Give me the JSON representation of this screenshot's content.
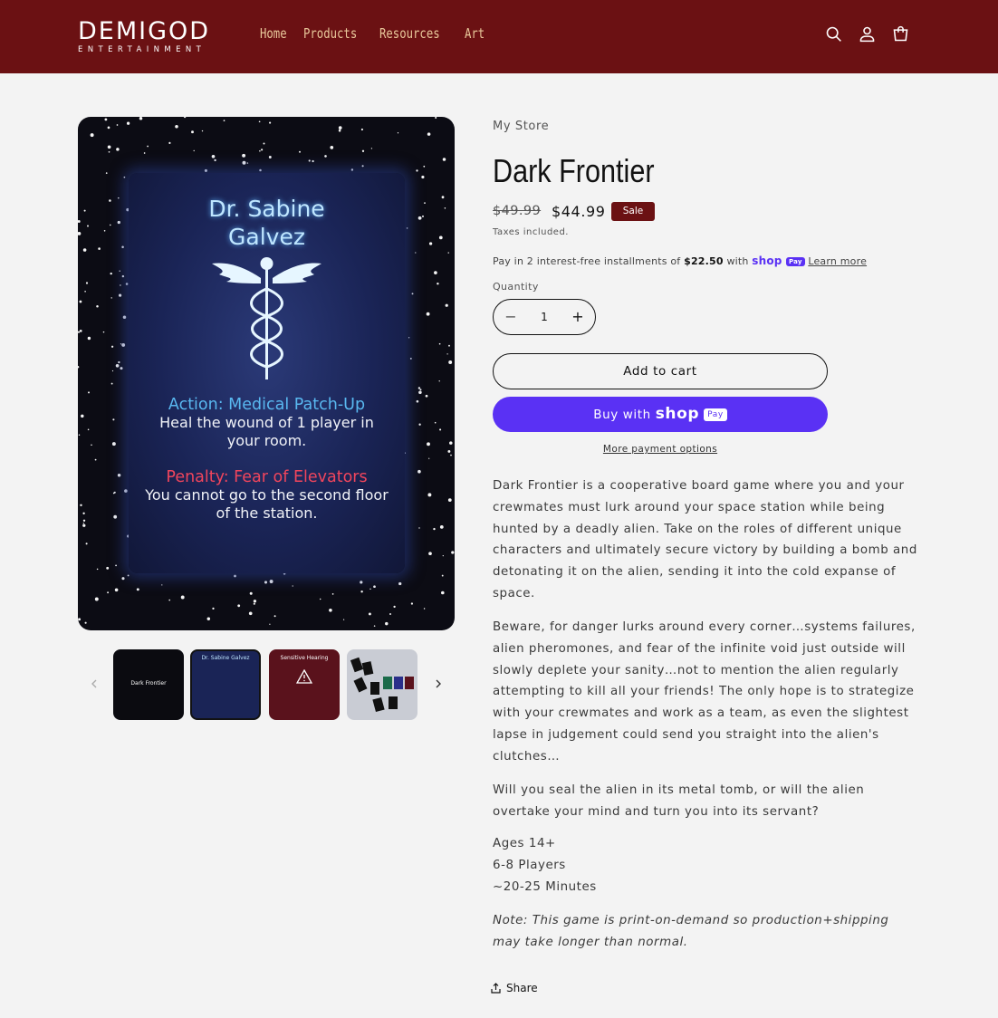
{
  "header": {
    "logo_main": "DEMIGOD",
    "logo_sub": "ENTERTAINMENT",
    "nav": [
      "Home",
      "Products",
      "Resources",
      "Art"
    ],
    "icons": [
      "search-icon",
      "account-icon",
      "cart-icon"
    ],
    "bg_color": "#6b1113",
    "nav_color": "#e8c79a"
  },
  "gallery": {
    "card": {
      "name_line1": "Dr. Sabine",
      "name_line2": "Galvez",
      "action_title": "Action: Medical Patch-Up",
      "action_text": "Heal the wound of 1 player in your room.",
      "penalty_title": "Penalty: Fear of Elevators",
      "penalty_text": "You cannot go to the second floor of the station."
    },
    "thumbnails": [
      {
        "label": "Dark Frontier"
      },
      {
        "label": "Dr. Sabine Galvez"
      },
      {
        "label": "Sensitive Hearing"
      },
      {
        "label": ""
      }
    ]
  },
  "product": {
    "store": "My Store",
    "title": "Dark Frontier",
    "price_old": "$49.99",
    "price_new": "$44.99",
    "sale_badge": "Sale",
    "taxes": "Taxes included.",
    "installments_prefix": "Pay in 2 interest-free installments of ",
    "installments_amount": "$22.50",
    "installments_with": " with ",
    "shop_word": "shop",
    "pay_word": "Pay",
    "learn_more": "Learn more",
    "quantity_label": "Quantity",
    "quantity_value": "1",
    "add_to_cart": "Add to cart",
    "buy_with": "Buy with",
    "more_payment": "More payment options",
    "description": [
      "Dark Frontier is a cooperative board game where you and your crewmates must lurk around your space station while being hunted by a deadly alien. Take on the roles of different unique characters and ultimately secure victory by building a bomb and detonating it on the alien, sending it into the cold expanse of space.",
      "Beware, for danger lurks around every corner…systems failures, alien pheromones, and fear of the infinite void just outside will slowly deplete your sanity…not to mention the alien regularly attempting to kill all your friends! The only hope is to strategize with your crewmates and work as a team, as even the slightest lapse in judgement could send you straight into the alien's clutches…",
      "Will you seal the alien in its metal tomb, or will the alien overtake your mind and turn you into its servant?"
    ],
    "specs": [
      "Ages 14+",
      "6-8 Players",
      "~20-25 Minutes"
    ],
    "note": "Note: This game is print-on-demand so production+shipping may take longer than normal.",
    "share": "Share",
    "accent_color": "#5a31f4",
    "sale_color": "#6b1113"
  }
}
